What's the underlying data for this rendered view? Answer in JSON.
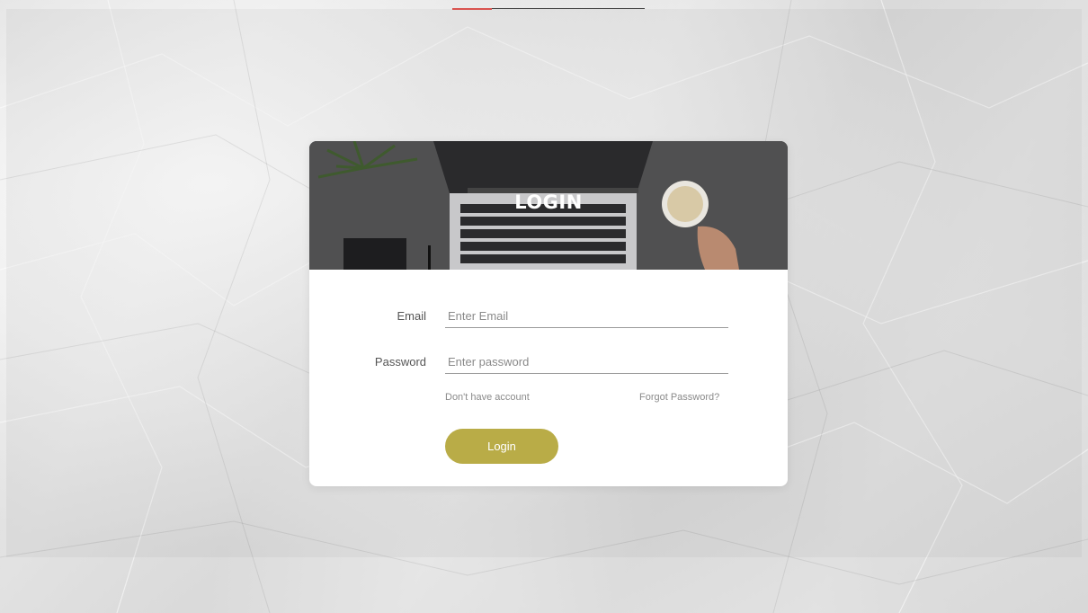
{
  "header": {
    "title": "LOGIN"
  },
  "form": {
    "email_label": "Email",
    "email_placeholder": "Enter Email",
    "email_value": "",
    "password_label": "Password",
    "password_placeholder": "Enter password",
    "password_value": "",
    "no_account_link": "Don't have account",
    "forgot_link": "Forgot Password?",
    "login_button": "Login"
  },
  "colors": {
    "button": "#b9ac47",
    "card": "#ffffff",
    "accent_strip": "#d9534f"
  },
  "icons": {
    "hero_image": "laptop-desk-photo"
  }
}
